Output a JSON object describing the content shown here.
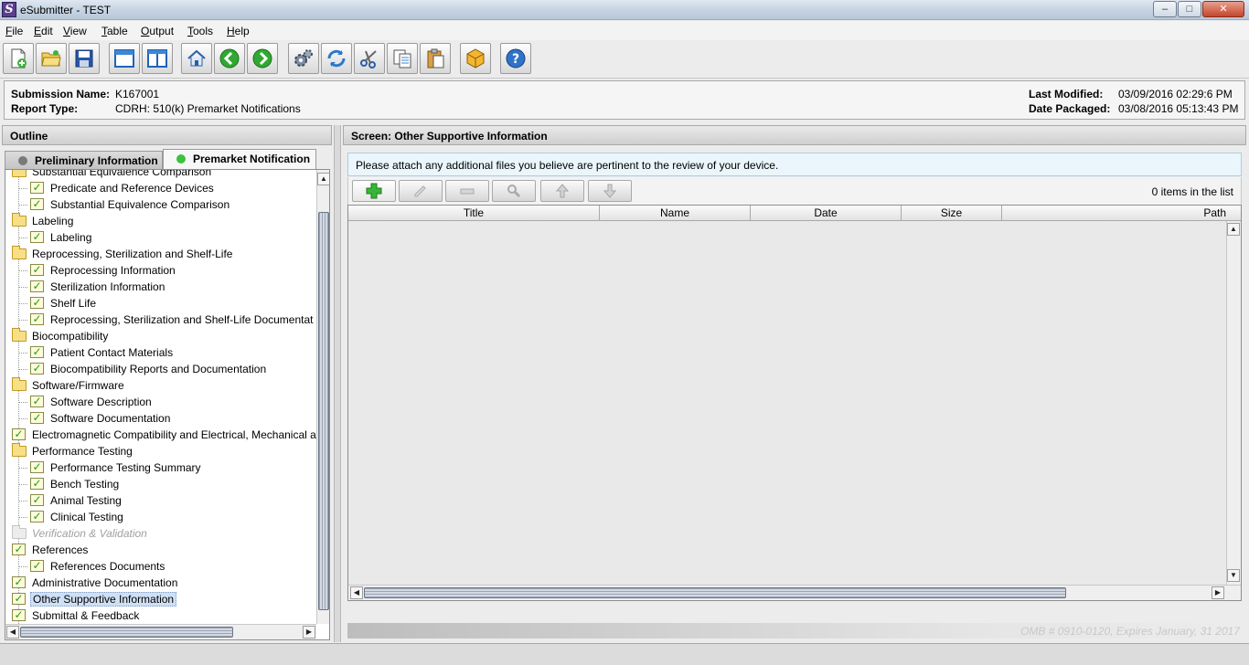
{
  "window": {
    "app_icon_letter": "S",
    "title": "eSubmitter - TEST",
    "minimize": "–",
    "maximize": "□",
    "close": "✕"
  },
  "menu": [
    {
      "label": "File",
      "u": "F",
      "rest": "ile"
    },
    {
      "label": "Edit",
      "u": "E",
      "rest": "dit"
    },
    {
      "label": "View",
      "u": "V",
      "rest": "iew"
    },
    {
      "label": "Table",
      "u": "T",
      "rest": "able"
    },
    {
      "label": "Output",
      "u": "O",
      "rest": "utput"
    },
    {
      "label": "Tools",
      "u": "T",
      "rest": "ools"
    },
    {
      "label": "Help",
      "u": "H",
      "rest": "elp"
    }
  ],
  "toolbar_icons": [
    "new-file-icon",
    "open-folder-icon",
    "save-icon",
    "window-icon",
    "split-view-icon",
    "home-icon",
    "back-arrow-icon",
    "forward-arrow-icon",
    "settings-gears-icon",
    "refresh-icon",
    "cut-scissors-icon",
    "copy-icon",
    "paste-icon",
    "package-icon",
    "help-icon"
  ],
  "info": {
    "submission_name_label": "Submission Name:",
    "submission_name": "K167001",
    "report_type_label": "Report Type:",
    "report_type": "CDRH: 510(k) Premarket Notifications",
    "last_modified_label": "Last Modified:",
    "last_modified": "03/09/2016 02:29:6 PM",
    "date_packaged_label": "Date Packaged:",
    "date_packaged": "03/08/2016 05:13:43 PM"
  },
  "outline": {
    "header": "Outline",
    "tabs": [
      {
        "label": "Preliminary Information",
        "dot_color": "#7a7a7a"
      },
      {
        "label": "Premarket Notification",
        "dot_color": "#3cc23c"
      }
    ],
    "partial_top_label": "Substantial Equivalence Comparison",
    "rows": [
      {
        "label": "Predicate and Reference Devices",
        "level": 1,
        "icon": "check"
      },
      {
        "label": "Substantial Equivalence Comparison",
        "level": 1,
        "icon": "check"
      },
      {
        "label": "Labeling",
        "level": 0,
        "icon": "folder"
      },
      {
        "label": "Labeling",
        "level": 1,
        "icon": "check"
      },
      {
        "label": "Reprocessing, Sterilization and Shelf-Life",
        "level": 0,
        "icon": "folder"
      },
      {
        "label": "Reprocessing Information",
        "level": 1,
        "icon": "check"
      },
      {
        "label": "Sterilization Information",
        "level": 1,
        "icon": "check"
      },
      {
        "label": "Shelf Life",
        "level": 1,
        "icon": "check"
      },
      {
        "label": "Reprocessing, Sterilization and Shelf-Life Documentat",
        "level": 1,
        "icon": "check"
      },
      {
        "label": "Biocompatibility",
        "level": 0,
        "icon": "folder"
      },
      {
        "label": "Patient Contact Materials",
        "level": 1,
        "icon": "check"
      },
      {
        "label": "Biocompatibility Reports and Documentation",
        "level": 1,
        "icon": "check"
      },
      {
        "label": "Software/Firmware",
        "level": 0,
        "icon": "folder"
      },
      {
        "label": "Software Description",
        "level": 1,
        "icon": "check"
      },
      {
        "label": "Software Documentation",
        "level": 1,
        "icon": "check"
      },
      {
        "label": "Electromagnetic Compatibility and Electrical, Mechanical a",
        "level": 0,
        "icon": "check"
      },
      {
        "label": "Performance Testing",
        "level": 0,
        "icon": "folder"
      },
      {
        "label": "Performance Testing Summary",
        "level": 1,
        "icon": "check"
      },
      {
        "label": "Bench Testing",
        "level": 1,
        "icon": "check"
      },
      {
        "label": "Animal Testing",
        "level": 1,
        "icon": "check"
      },
      {
        "label": "Clinical Testing",
        "level": 1,
        "icon": "check"
      },
      {
        "label": "Verification & Validation",
        "level": 0,
        "icon": "folder-grey",
        "disabled": true
      },
      {
        "label": "References",
        "level": 0,
        "icon": "check"
      },
      {
        "label": "References Documents",
        "level": 1,
        "icon": "check"
      },
      {
        "label": "Administrative Documentation",
        "level": 0,
        "icon": "check"
      },
      {
        "label": "Other Supportive Information",
        "level": 0,
        "icon": "check",
        "selected": true
      },
      {
        "label": "Submittal & Feedback",
        "level": 0,
        "icon": "check"
      }
    ]
  },
  "screen": {
    "header": "Screen: Other Supportive Information",
    "instruction": "Please attach any additional files you believe are pertinent to the review of your device.",
    "list_buttons": [
      "add-icon",
      "edit-pencil-icon",
      "remove-icon",
      "view-magnifier-icon",
      "move-up-icon",
      "move-down-icon"
    ],
    "item_count": "0 items in the list",
    "columns": [
      "Title",
      "Name",
      "Date",
      "Size",
      "Path"
    ],
    "omb": "OMB # 0910-0120, Expires January, 31 2017"
  }
}
